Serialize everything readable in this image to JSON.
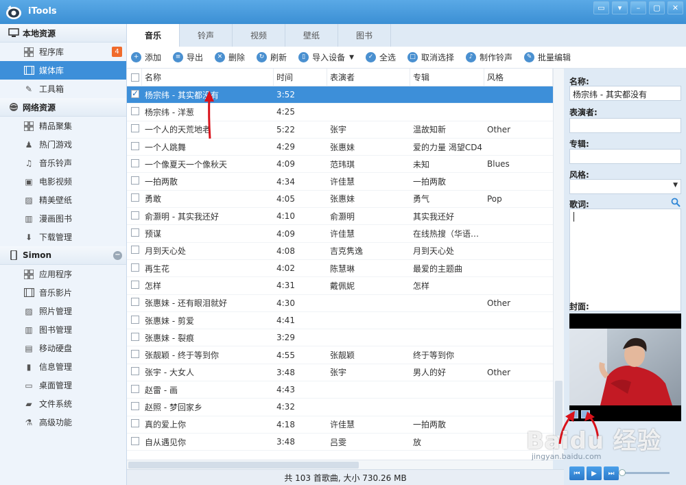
{
  "app": {
    "title": "iTools"
  },
  "window_buttons": [
    "feedback-icon",
    "menu-icon",
    "minimize-icon",
    "maximize-icon",
    "close-icon"
  ],
  "sidebar": {
    "sections": [
      {
        "label": "本地资源",
        "icon": "monitor-icon",
        "items": [
          {
            "label": "程序库",
            "icon": "grid-icon",
            "badge": "4"
          },
          {
            "label": "媒体库",
            "icon": "film-icon",
            "active": true
          },
          {
            "label": "工具箱",
            "icon": "wrench-icon"
          }
        ]
      },
      {
        "label": "网络资源",
        "icon": "globe-icon",
        "items": [
          {
            "label": "精品聚集",
            "icon": "grid-icon"
          },
          {
            "label": "热门游戏",
            "icon": "game-icon"
          },
          {
            "label": "音乐铃声",
            "icon": "music-icon"
          },
          {
            "label": "电影视频",
            "icon": "video-icon"
          },
          {
            "label": "精美壁纸",
            "icon": "picture-icon"
          },
          {
            "label": "漫画图书",
            "icon": "book-icon"
          },
          {
            "label": "下载管理",
            "icon": "download-icon"
          }
        ]
      },
      {
        "label": "Simon",
        "icon": "phone-icon",
        "items": [
          {
            "label": "应用程序",
            "icon": "grid-icon"
          },
          {
            "label": "音乐影片",
            "icon": "film-icon"
          },
          {
            "label": "照片管理",
            "icon": "picture-icon"
          },
          {
            "label": "图书管理",
            "icon": "book-icon"
          },
          {
            "label": "移动硬盘",
            "icon": "disk-icon"
          },
          {
            "label": "信息管理",
            "icon": "contact-icon"
          },
          {
            "label": "桌面管理",
            "icon": "desktop-icon"
          },
          {
            "label": "文件系统",
            "icon": "folder-icon"
          },
          {
            "label": "高级功能",
            "icon": "flask-icon"
          }
        ]
      }
    ]
  },
  "tabs": [
    {
      "label": "音乐",
      "active": true
    },
    {
      "label": "铃声"
    },
    {
      "label": "视频"
    },
    {
      "label": "壁纸"
    },
    {
      "label": "图书"
    }
  ],
  "toolbar": [
    {
      "label": "添加",
      "icon": "add-icon",
      "glyph": "+"
    },
    {
      "label": "导出",
      "icon": "export-icon",
      "glyph": "≡"
    },
    {
      "label": "删除",
      "icon": "delete-icon",
      "glyph": "✕"
    },
    {
      "label": "刷新",
      "icon": "refresh-icon",
      "glyph": "↻"
    },
    {
      "label": "导入设备",
      "icon": "import-icon",
      "glyph": "▯",
      "dropdown": true
    },
    {
      "label": "全选",
      "icon": "select-all-icon",
      "glyph": "✓"
    },
    {
      "label": "取消选择",
      "icon": "deselect-icon",
      "glyph": "□"
    },
    {
      "label": "制作铃声",
      "icon": "bell-icon",
      "glyph": "♪"
    },
    {
      "label": "批量编辑",
      "icon": "batch-edit-icon",
      "glyph": "✎"
    }
  ],
  "table": {
    "columns": [
      "名称",
      "时间",
      "表演者",
      "专辑",
      "风格"
    ],
    "rows": [
      {
        "name": "杨宗纬 - 其实都没有",
        "time": "3:52",
        "artist": "",
        "album": "",
        "genre": "",
        "checked": true,
        "selected": true
      },
      {
        "name": "杨宗纬 - 洋葱",
        "time": "4:25",
        "artist": "",
        "album": "",
        "genre": ""
      },
      {
        "name": "一个人的天荒地老",
        "time": "5:22",
        "artist": "张宇",
        "album": "温故知新",
        "genre": "Other"
      },
      {
        "name": "一个人跳舞",
        "time": "4:29",
        "artist": "张惠妹",
        "album": "爱的力量 渴望CD4",
        "genre": ""
      },
      {
        "name": "一个像夏天一个像秋天",
        "time": "4:09",
        "artist": "范玮琪",
        "album": "未知",
        "genre": "Blues"
      },
      {
        "name": "一拍两散",
        "time": "4:34",
        "artist": "许佳慧",
        "album": "一拍两散",
        "genre": ""
      },
      {
        "name": "勇敢",
        "time": "4:05",
        "artist": "张惠妹",
        "album": "勇气",
        "genre": "Pop"
      },
      {
        "name": "俞灏明 - 其实我还好",
        "time": "4:10",
        "artist": "俞灏明",
        "album": "其实我还好",
        "genre": ""
      },
      {
        "name": "预谋",
        "time": "4:09",
        "artist": "许佳慧",
        "album": "在线热搜（华语）…",
        "genre": ""
      },
      {
        "name": "月到天心处",
        "time": "4:08",
        "artist": "吉克隽逸",
        "album": "月到天心处",
        "genre": ""
      },
      {
        "name": "再生花",
        "time": "4:02",
        "artist": "陈慧琳",
        "album": "最爱的主题曲",
        "genre": ""
      },
      {
        "name": "怎样",
        "time": "4:31",
        "artist": "戴佩妮",
        "album": "怎样",
        "genre": ""
      },
      {
        "name": "张惠妹 - 还有眼泪就好",
        "time": "4:30",
        "artist": "",
        "album": "",
        "genre": "Other"
      },
      {
        "name": "张惠妹 - 剪爱",
        "time": "4:41",
        "artist": "",
        "album": "",
        "genre": ""
      },
      {
        "name": "张惠妹 - 裂痕",
        "time": "3:29",
        "artist": "",
        "album": "",
        "genre": ""
      },
      {
        "name": "张靓颖 - 终于等到你",
        "time": "4:55",
        "artist": "张靓颖",
        "album": "终于等到你",
        "genre": ""
      },
      {
        "name": "张宇 - 大女人",
        "time": "3:48",
        "artist": "张宇",
        "album": "男人的好",
        "genre": "Other"
      },
      {
        "name": "赵雷 - 画",
        "time": "4:43",
        "artist": "",
        "album": "",
        "genre": ""
      },
      {
        "name": "赵照 - 梦回家乡",
        "time": "4:32",
        "artist": "",
        "album": "",
        "genre": ""
      },
      {
        "name": "真的爱上你",
        "time": "4:18",
        "artist": "许佳慧",
        "album": "一拍两散",
        "genre": ""
      },
      {
        "name": "自从遇见你",
        "time": "3:48",
        "artist": "吕雯",
        "album": "放",
        "genre": ""
      }
    ]
  },
  "status": {
    "text": "共 103 首歌曲, 大小 730.26 MB"
  },
  "panel": {
    "name_label": "名称:",
    "name_value": "杨宗纬 - 其实都没有",
    "artist_label": "表演者:",
    "artist_value": "",
    "album_label": "专辑:",
    "album_value": "",
    "genre_label": "风格:",
    "genre_value": "",
    "lyrics_label": "歌词:",
    "cover_label": "封面:"
  },
  "player_buttons": [
    "previous-icon",
    "play-icon",
    "next-icon"
  ],
  "watermark": {
    "text": "Baidu 经验",
    "url": "jingyan.baidu.com"
  },
  "colors": {
    "accent": "#3d8fd9",
    "titlebar": "#4a9ddd",
    "badge": "#f06b2c",
    "annotation": "#d9121b"
  }
}
